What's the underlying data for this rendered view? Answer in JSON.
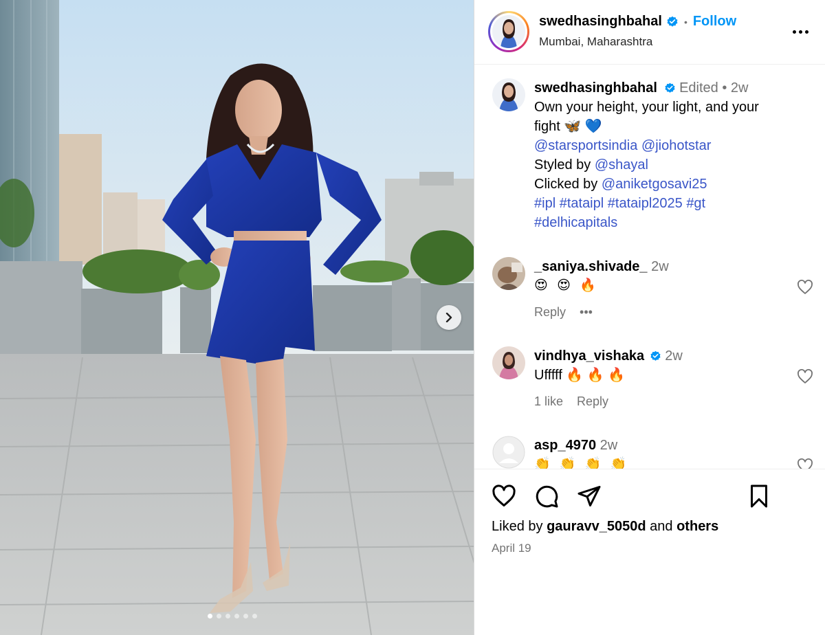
{
  "post": {
    "carousel_dots": 6,
    "active_dot": 0
  },
  "header": {
    "username": "swedhasinghbahal",
    "separator": "•",
    "follow_label": "Follow",
    "location": "Mumbai, Maharashtra"
  },
  "caption": {
    "username": "swedhasinghbahal",
    "edited": "Edited",
    "separator": "•",
    "time": "2w",
    "text_line1": "Own your height, your light, and your",
    "text_line2": "fight 🦋 💙",
    "mention1": "@starsportsindia",
    "mention2": "@jiohotstar",
    "styled_by_prefix": "Styled by ",
    "styled_by": "@shayal",
    "clicked_by_prefix": "Clicked by ",
    "clicked_by": "@aniketgosavi25",
    "hashtags_line1": [
      "#ipl",
      "#tataipl",
      "#tataipl2025",
      "#gt"
    ],
    "hashtags_line2": "#delhicapitals"
  },
  "comments": [
    {
      "username": "_saniya.shivade_",
      "time": "2w",
      "text": "😍 😍 🔥",
      "reply_label": "Reply",
      "more_label": "•••"
    },
    {
      "username": "vindhya_vishaka",
      "time": "2w",
      "text": "Ufffff 🔥 🔥 🔥",
      "likes_label": "1 like",
      "reply_label": "Reply"
    },
    {
      "username": "asp_4970",
      "time": "2w",
      "text": "👏 👏 👏 👏"
    }
  ],
  "footer": {
    "liked_prefix": "Liked by ",
    "liked_user": "gauravv_5050d",
    "liked_mid": " and ",
    "liked_others": "others",
    "date": "April 19"
  },
  "colors": {
    "link": "#3a56c8",
    "follow": "#0095f6",
    "verified": "#0095f6",
    "muted": "#737373"
  },
  "icons": [
    "verified-badge-icon",
    "more-options-icon",
    "heart-icon",
    "comment-icon",
    "share-icon",
    "bookmark-icon",
    "chevron-right-icon"
  ]
}
